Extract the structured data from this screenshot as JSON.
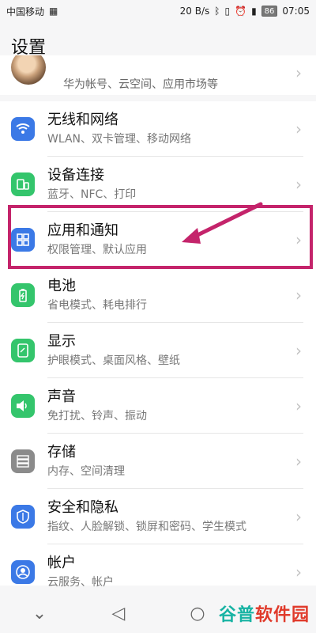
{
  "status": {
    "carrier": "中国移动",
    "net_speed": "20 B/s",
    "battery": "86",
    "time": "07:05",
    "icons": [
      "bluetooth-icon",
      "vibrate-icon",
      "alarm-icon",
      "signal-icon"
    ]
  },
  "header": {
    "title": "设置"
  },
  "account": {
    "subtitle": "华为帐号、云空间、应用市场等"
  },
  "rows": [
    {
      "title": "无线和网络",
      "subtitle": "WLAN、双卡管理、移动网络",
      "icon": "wifi-icon",
      "color": "#3b79e6"
    },
    {
      "title": "设备连接",
      "subtitle": "蓝牙、NFC、打印",
      "icon": "device-connect-icon",
      "color": "#34c56c"
    },
    {
      "title": "应用和通知",
      "subtitle": "权限管理、默认应用",
      "icon": "apps-icon",
      "color": "#3b79e6"
    },
    {
      "title": "电池",
      "subtitle": "省电模式、耗电排行",
      "icon": "battery-icon",
      "color": "#34c56c"
    },
    {
      "title": "显示",
      "subtitle": "护眼模式、桌面风格、壁纸",
      "icon": "display-icon",
      "color": "#34c56c"
    },
    {
      "title": "声音",
      "subtitle": "免打扰、铃声、振动",
      "icon": "sound-icon",
      "color": "#34c56c"
    },
    {
      "title": "存储",
      "subtitle": "内存、空间清理",
      "icon": "storage-icon",
      "color": "#8b8b8b"
    },
    {
      "title": "安全和隐私",
      "subtitle": "指纹、人脸解锁、锁屏和密码、学生模式",
      "icon": "shield-icon",
      "color": "#3b79e6"
    },
    {
      "title": "帐户",
      "subtitle": "云服务、帐户",
      "icon": "account-icon",
      "color": "#3b79e6"
    }
  ],
  "highlight": {
    "color": "#c4246b"
  },
  "nav": {
    "icons": [
      "chevron-down-icon",
      "back-icon",
      "home-icon"
    ]
  },
  "watermark": {
    "text_a": "谷普",
    "text_b": "软件园"
  }
}
